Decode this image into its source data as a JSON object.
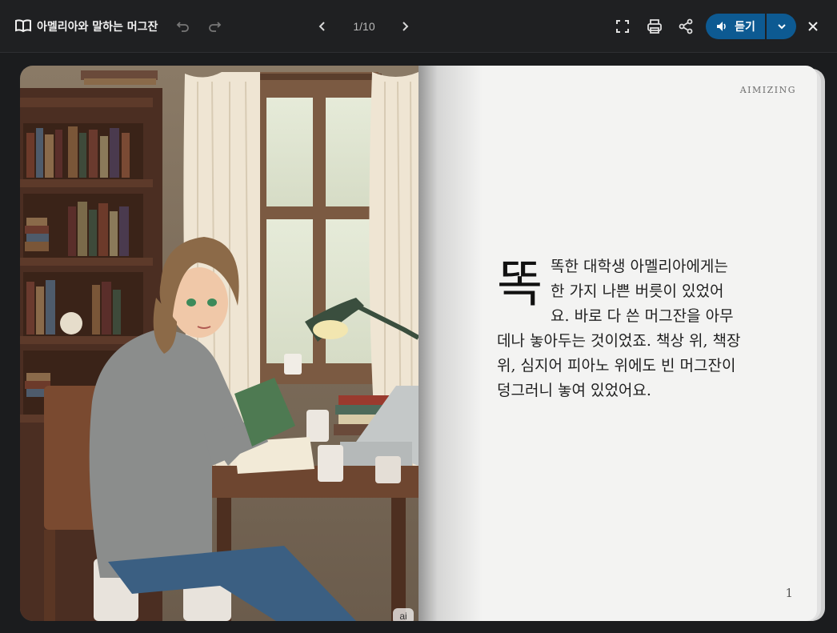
{
  "header": {
    "book_title": "아멜리아와 말하는 머그잔",
    "pager": "1/10",
    "listen_label": "듣기"
  },
  "icons": {
    "book": "book-open-icon",
    "undo": "undo-icon",
    "redo": "redo-icon",
    "prev": "chevron-left-icon",
    "next": "chevron-right-icon",
    "fullscreen": "fullscreen-icon",
    "print": "printer-icon",
    "share": "share-icon",
    "speaker": "speaker-icon",
    "dropdown": "chevron-down-icon",
    "close": "close-icon"
  },
  "page": {
    "brand": "AIMIZING",
    "dropcap": "똑",
    "text": "똑한 대학생 아멜리아에게는 한 가지 나쁜 버릇이 있었어요. 바로 다 쓴 머그잔을 아무 데나 놓아두는 것이었죠. 책상 위, 책장 위, 심지어 피아노 위에도 빈 머그잔이 덩그러니 놓여 있었어요.",
    "page_number": "1",
    "ai_badge": "ai"
  },
  "colors": {
    "background": "#1b1c1e",
    "accent": "#0d5a92",
    "paper": "#f3f3f2"
  }
}
